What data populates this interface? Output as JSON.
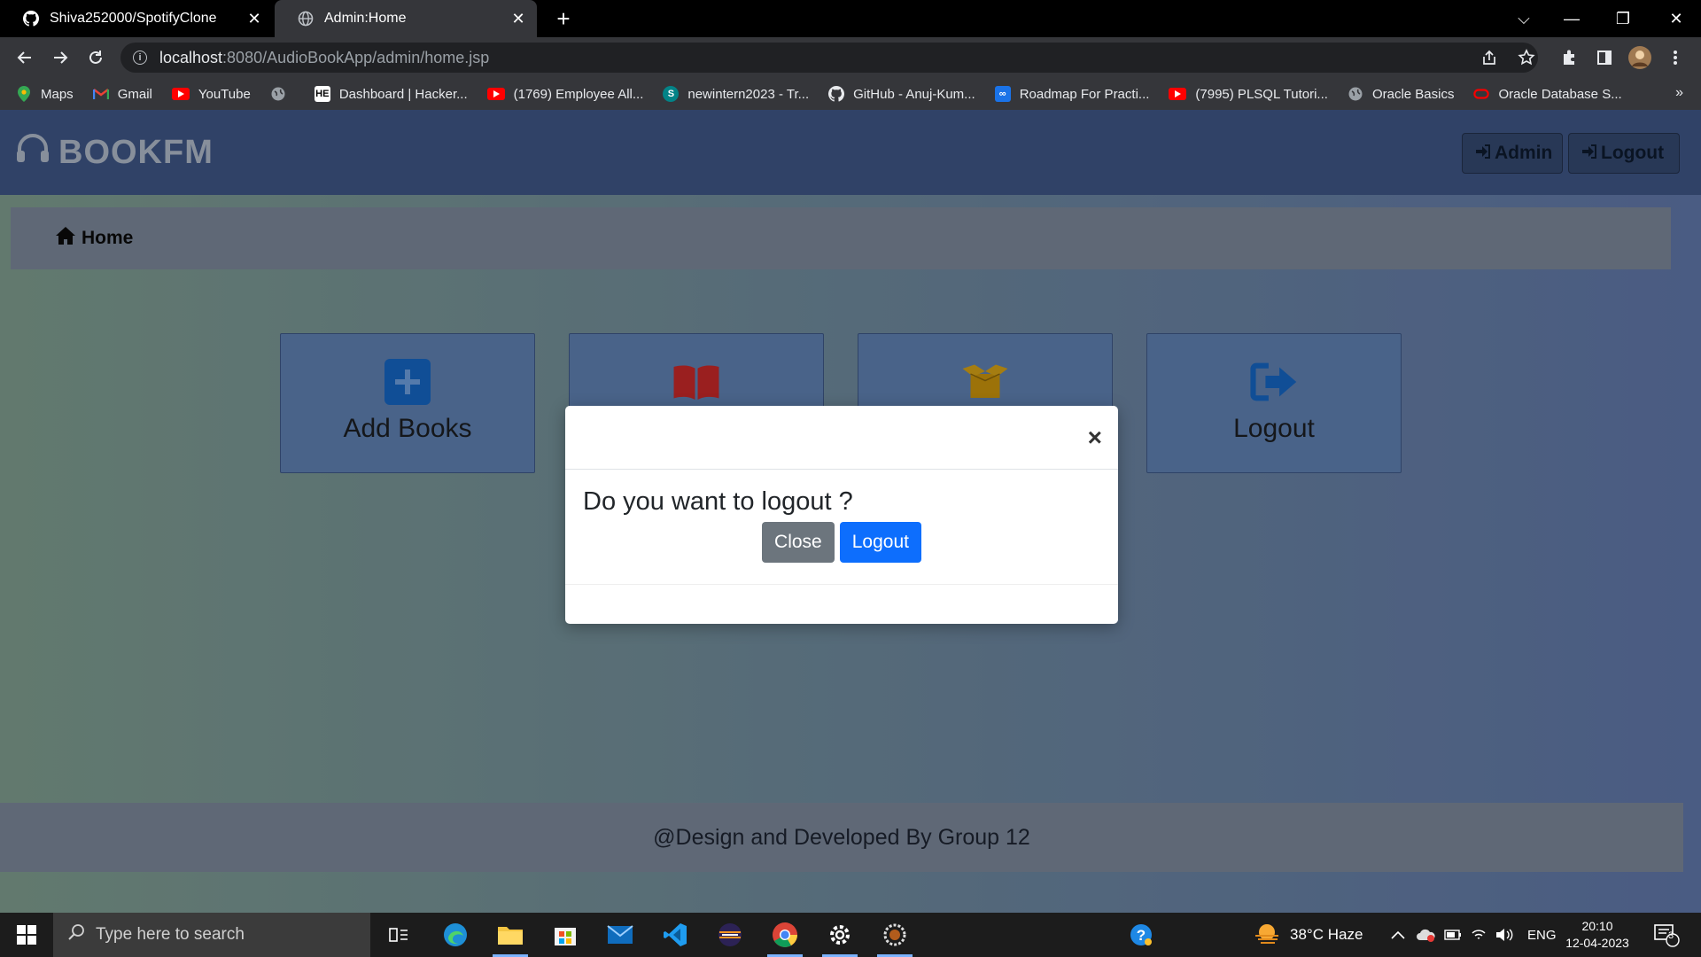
{
  "browser": {
    "tabs": [
      {
        "title": "Shiva252000/SpotifyClone"
      },
      {
        "title": "Admin:Home"
      }
    ],
    "url_host": "localhost",
    "url_path": ":8080/AudioBookApp/admin/home.jsp",
    "bookmarks": [
      {
        "label": "Maps",
        "icon": "maps-icon"
      },
      {
        "label": "Gmail",
        "icon": "gmail-icon"
      },
      {
        "label": "YouTube",
        "icon": "youtube-icon"
      },
      {
        "label": "",
        "icon": "globe-icon"
      },
      {
        "label": "Dashboard | Hacker...",
        "icon": "hackerearth-icon"
      },
      {
        "label": "(1769) Employee All...",
        "icon": "youtube-icon"
      },
      {
        "label": "newintern2023 - Tr...",
        "icon": "sharepoint-icon"
      },
      {
        "label": "GitHub - Anuj-Kum...",
        "icon": "github-icon"
      },
      {
        "label": "Roadmap For Practi...",
        "icon": "link-icon"
      },
      {
        "label": "(7995) PLSQL Tutori...",
        "icon": "youtube-icon"
      },
      {
        "label": "Oracle Basics",
        "icon": "globe-icon"
      },
      {
        "label": "Oracle Database S...",
        "icon": "oracle-icon"
      }
    ],
    "more_bookmarks": "»"
  },
  "app": {
    "brand": "BOOKFM",
    "nav": {
      "admin_label": "Admin",
      "logout_label": "Logout"
    },
    "breadcrumb": "Home",
    "cards": [
      {
        "label": "Add Books",
        "icon": "plus-square-icon"
      },
      {
        "label": "",
        "icon": "book-open-icon"
      },
      {
        "label": "",
        "icon": "box-open-icon"
      },
      {
        "label": "Logout",
        "icon": "sign-out-icon"
      }
    ],
    "footer": "@Design and Developed By Group 12"
  },
  "modal": {
    "close_glyph": "×",
    "question": "Do you want to logout ?",
    "close_button": "Close",
    "logout_button": "Logout"
  },
  "taskbar": {
    "search_placeholder": "Type here to search",
    "weather": "38°C  Haze",
    "language": "ENG",
    "time": "20:10",
    "date": "12-04-2023",
    "notifications": "3"
  },
  "colors": {
    "navbar": "#3e5585",
    "card": "#5e7fb0",
    "primary": "#0d6efd",
    "secondary": "#6c757d",
    "book_red": "#c62828",
    "box_gold": "#d4a017",
    "icon_blue": "#1565c0"
  }
}
